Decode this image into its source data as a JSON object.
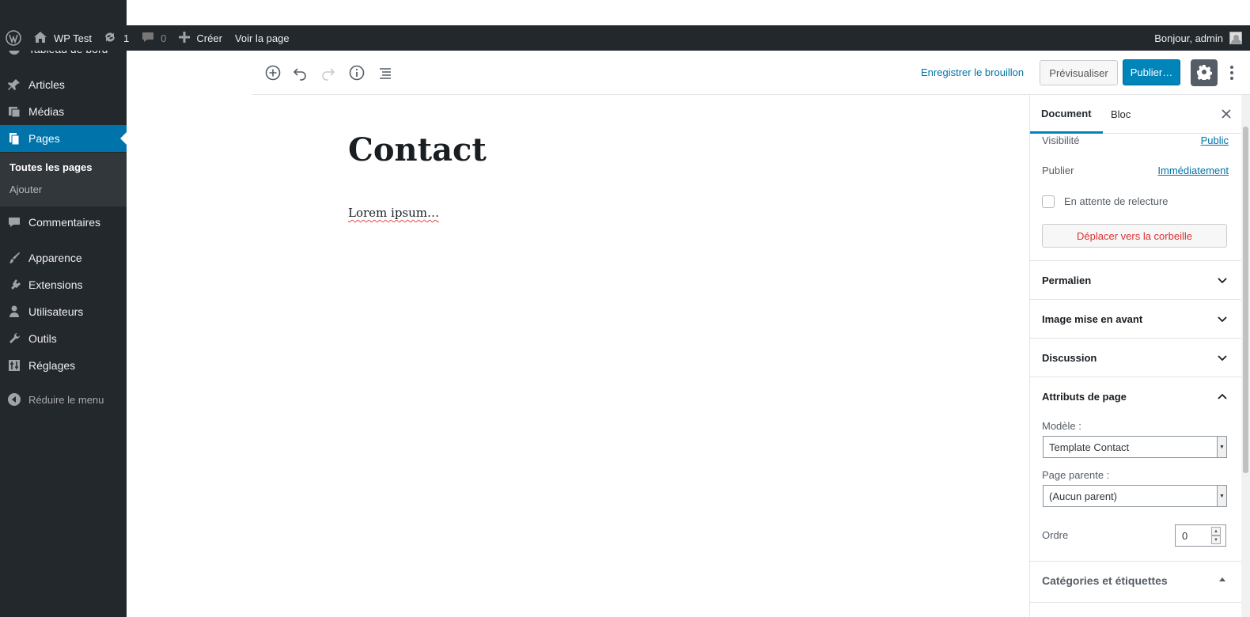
{
  "adminbar": {
    "site_name": "WP Test",
    "updates_count": "1",
    "comments_count": "0",
    "new_label": "Créer",
    "view_page_label": "Voir la page",
    "greeting": "Bonjour, admin"
  },
  "menu": {
    "partial_item": "Tableau de bord",
    "items": [
      {
        "label": "Articles"
      },
      {
        "label": "Médias"
      },
      {
        "label": "Pages"
      },
      {
        "label": "Commentaires"
      },
      {
        "label": "Apparence"
      },
      {
        "label": "Extensions"
      },
      {
        "label": "Utilisateurs"
      },
      {
        "label": "Outils"
      },
      {
        "label": "Réglages"
      }
    ],
    "submenu": [
      {
        "label": "Toutes les pages"
      },
      {
        "label": "Ajouter"
      }
    ],
    "collapse_label": "Réduire le menu"
  },
  "toolbar": {
    "save_draft": "Enregistrer le brouillon",
    "preview": "Prévisualiser",
    "publish": "Publier…"
  },
  "content": {
    "title": "Contact",
    "body": "Lorem ipsum…"
  },
  "sidebar": {
    "tabs": [
      {
        "label": "Document"
      },
      {
        "label": "Bloc"
      }
    ],
    "visibility_label": "Visibilité",
    "visibility_value": "Public",
    "publish_label": "Publier",
    "publish_value": "Immédiatement",
    "pending_review_label": "En attente de relecture",
    "trash_label": "Déplacer vers la corbeille",
    "panels": {
      "permalink": "Permalien",
      "featured_image": "Image mise en avant",
      "discussion": "Discussion",
      "page_attributes": "Attributs de page",
      "categories_tags": "Catégories et étiquettes"
    },
    "template_label": "Modèle :",
    "template_value": "Template Contact",
    "parent_label": "Page parente :",
    "parent_value": "(Aucun parent)",
    "order_label": "Ordre",
    "order_value": "0"
  },
  "colors": {
    "accent": "#0085ba",
    "admin_bg": "#23282d",
    "menu_active": "#0073aa",
    "link": "#0073aa",
    "danger": "#dc3232"
  }
}
